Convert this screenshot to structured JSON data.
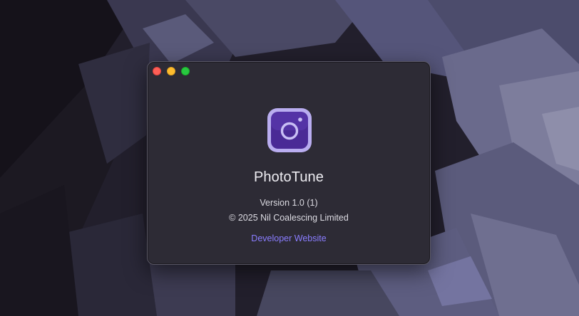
{
  "window": {
    "traffic_lights": [
      "close",
      "minimize",
      "zoom"
    ]
  },
  "about": {
    "app_icon": "camera-app-icon",
    "app_name": "PhotoTune",
    "version": "Version 1.0 (1)",
    "copyright": "© 2025 Nil Coalescing Limited",
    "developer_link": "Developer Website"
  },
  "colors": {
    "accent_link": "#8a7dff",
    "icon_purple": "#5a3aa8",
    "icon_lavender": "#b9adf0",
    "window_bg": "#2d2b35"
  }
}
